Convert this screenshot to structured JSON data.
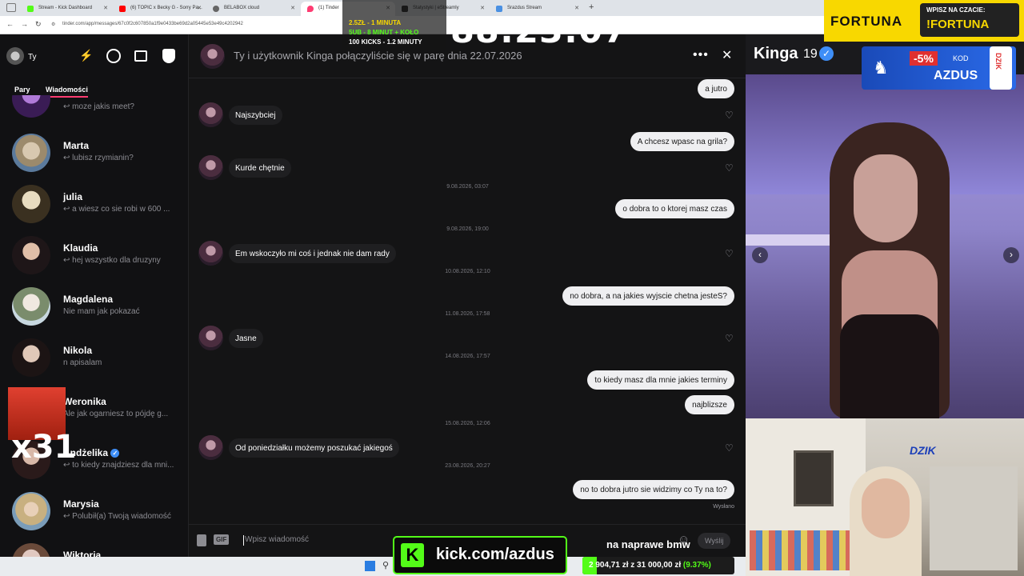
{
  "browser": {
    "tabs": [
      {
        "label": "Stream - Kick Dashboard",
        "color": "#53fc18"
      },
      {
        "label": "(6) TOPIC x Becky G - Sorry Pa...",
        "color": "#ff0000"
      },
      {
        "label": "BELABOX cloud",
        "color": "#555555"
      },
      {
        "label": "(1) Tinder",
        "color": "#fe3c72"
      },
      {
        "label": "Statystyki | eStreamly",
        "color": "#222222"
      },
      {
        "label": "Srazdus Stream",
        "color": "#4a90e2"
      }
    ],
    "url": "tinder.com/app/messages/67c0f2c607850a1f9e0433be69d2a05445e53e49c4202942"
  },
  "sidebar": {
    "user_label": "Ty",
    "tabs": [
      "Pary",
      "Wiadomości"
    ],
    "conversations": [
      {
        "name": "",
        "preview": "moze jakis meet?"
      },
      {
        "name": "Marta",
        "preview": "lubisz rzymianin?"
      },
      {
        "name": "julia",
        "preview": "a wiesz co sie robi w 600 ..."
      },
      {
        "name": "Klaudia",
        "preview": "hej wszystko dla druzyny"
      },
      {
        "name": "Magdalena",
        "preview": "Nie mam jak pokazać"
      },
      {
        "name": "Nikola",
        "preview": "n apisalam"
      },
      {
        "name": "Weronika",
        "preview": "Ale jak ogarniesz to pójdę g..."
      },
      {
        "name": "Andżelika",
        "preview": "to kiedy znajdziesz dla mni..."
      },
      {
        "name": "Marysia",
        "preview": "Polubił(a) Twoją wiadomość"
      },
      {
        "name": "Wiktoria",
        "preview": ""
      }
    ]
  },
  "chat": {
    "header_title": "Ty i użytkownik Kinga połączyliście się w parę dnia 22.07.2026",
    "messages": [
      {
        "type": "out",
        "text": "a jutro"
      },
      {
        "type": "in",
        "text": "Najszybciej"
      },
      {
        "type": "out",
        "text": "A chcesz wpasc na grila?"
      },
      {
        "type": "in",
        "text": "Kurde chętnie"
      },
      {
        "type": "ts",
        "text": "9.08.2026, 03:07"
      },
      {
        "type": "out",
        "text": "o dobra to o ktorej masz czas"
      },
      {
        "type": "ts",
        "text": "9.08.2026, 19:00"
      },
      {
        "type": "in",
        "text": "Em wskoczyło mi coś i jednak nie dam rady"
      },
      {
        "type": "ts",
        "text": "10.08.2026, 12:10"
      },
      {
        "type": "out",
        "text": "no dobra, a na jakies wyjscie chetna jesteS?"
      },
      {
        "type": "ts",
        "text": "11.08.2026, 17:58"
      },
      {
        "type": "in",
        "text": "Jasne"
      },
      {
        "type": "ts",
        "text": "14.08.2026, 17:57"
      },
      {
        "type": "out",
        "text": "to kiedy masz dla mnie jakies terminy"
      },
      {
        "type": "out",
        "text": "najblizsze"
      },
      {
        "type": "ts",
        "text": "15.08.2026, 12:06"
      },
      {
        "type": "in",
        "text": "Od poniedziałku możemy poszukać jakiegoś"
      },
      {
        "type": "ts",
        "text": "23.08.2026, 20:27"
      },
      {
        "type": "out",
        "text": "no to dobra jutro sie widzimy co Ty na to?"
      }
    ],
    "sent_label": "Wysłano",
    "composer_placeholder": "Wpisz wiadomość",
    "send_label": "Wyślij",
    "gif_label": "GIF"
  },
  "profile": {
    "name": "Kinga",
    "age": "19"
  },
  "overlays": {
    "timer": "88:23:07",
    "timer_rules": [
      "2.5ZŁ - 1 MINUTA",
      "5UB - 8 MINUT + KOŁO",
      "100 KICKS - 1.2 MINUTY"
    ],
    "fortuna_brand": "FORTUNA",
    "fortuna_cta": "WPISZ NA CZACIE:",
    "fortuna_command": "!FORTUNA",
    "promo_discount": "-5%",
    "promo_kod": "KOD",
    "promo_code": "AZDUS",
    "promo_can": "DZIK",
    "kick_url": "kick.com/azdus",
    "stream_caption": "na naprawe bmw",
    "money_current": "2 904,71 zł",
    "money_of": "z",
    "money_goal": "31 000,00 zł",
    "money_pct": "(9.37%)",
    "x31_label": "x31",
    "dzik_logo": "DZIK"
  },
  "colors": {
    "tinder_accent": "#fe3c72",
    "kick_green": "#53fc18",
    "fortuna_yellow": "#f8d800",
    "verified_blue": "#3e8ef7"
  }
}
